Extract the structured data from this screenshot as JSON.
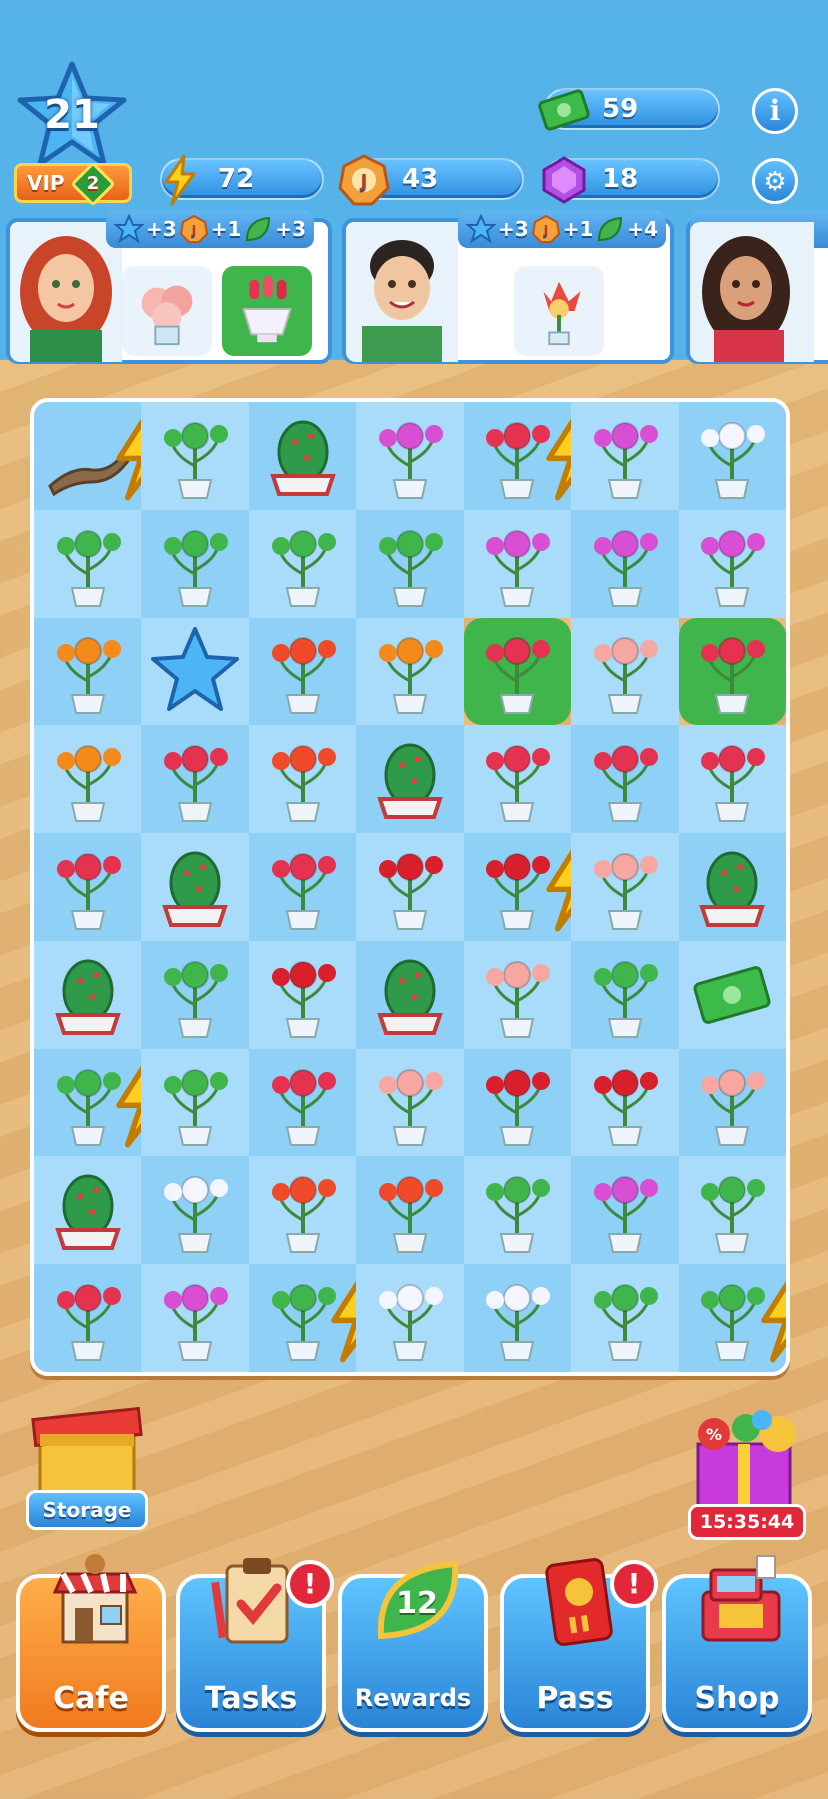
{
  "player": {
    "level": "21",
    "vip_label": "VIP",
    "vip_level": "2"
  },
  "currencies": {
    "cash": "59",
    "energy": "72",
    "coins": "43",
    "gems": "18"
  },
  "orders": [
    {
      "rewards": [
        {
          "icon": "star-icon",
          "amount": "+3"
        },
        {
          "icon": "coin-icon",
          "amount": "+1"
        },
        {
          "icon": "leaf-icon",
          "amount": "+3"
        }
      ],
      "items": [
        "pink-peony-bouquet",
        "tulips-in-white-urn"
      ]
    },
    {
      "rewards": [
        {
          "icon": "star-icon",
          "amount": "+3"
        },
        {
          "icon": "coin-icon",
          "amount": "+1"
        },
        {
          "icon": "leaf-icon",
          "amount": "+4"
        }
      ],
      "items": [
        "protea-in-vase"
      ]
    }
  ],
  "board": [
    [
      "driftwood",
      "bromeliad",
      "cactus-pot",
      "white-orchid",
      "tulip-pot",
      "orchid-pot",
      "lily-vase"
    ],
    [
      "plant-stand",
      "bromeliad-pot",
      "eucalyptus",
      "succulent-pot",
      "orchid-vase",
      "orchid-pink",
      "orchid-yellow"
    ],
    [
      "bird-of-paradise",
      "star",
      "amaryllis",
      "bird-of-paradise",
      "tulips-urn",
      "peony",
      "tulips-urn"
    ],
    [
      "bird-of-paradise",
      "tulip-box",
      "amaryllis",
      "cactus-bowl",
      "tulip-bucket",
      "tulip-vase",
      "tulip-basket"
    ],
    [
      "tulip-bouquet",
      "cactus-bowl",
      "tulip-bucket",
      "rose-box",
      "rose-bucket",
      "peony",
      "cactus-bowl"
    ],
    [
      "cactus-bowl",
      "jade-pot",
      "rose-vase",
      "cactus-bowl",
      "peony",
      "aloe-pot",
      "cash-note"
    ],
    [
      "succulent-basket",
      "aloe-pot",
      "tulip-vase",
      "peony",
      "rose-dome",
      "rose-vase",
      "peony"
    ],
    [
      "cactus-tall",
      "lily-vase",
      "amaryllis",
      "amaryllis",
      "fern-arrangement",
      "white-orchid",
      "eucalyptus"
    ],
    [
      "tulip-basket",
      "orchid-glass",
      "plant-crate",
      "calla-lily",
      "lily-white",
      "willow-vase",
      "sprout-pot"
    ]
  ],
  "storage_label": "Storage",
  "promo_timer": "15:35:44",
  "nav": {
    "cafe": "Cafe",
    "tasks": "Tasks",
    "rewards": "Rewards",
    "rewards_count": "12",
    "pass": "Pass",
    "shop": "Shop",
    "alert_mark": "!"
  },
  "colors": {
    "sky": "#55b3ea",
    "board_cell_a": "#8fd0f7",
    "board_cell_b": "#a9dcfb",
    "accent_green": "#3fb54c",
    "active_orange": "#f07a1e"
  }
}
